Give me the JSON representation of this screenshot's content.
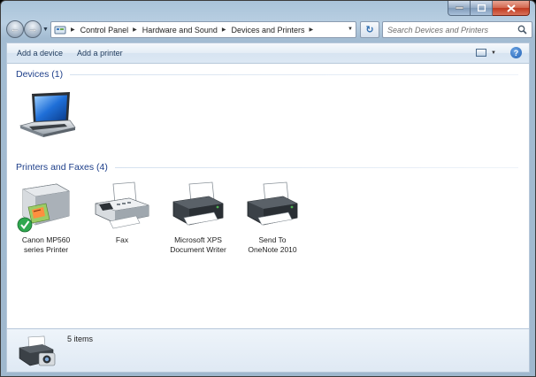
{
  "nav": {
    "breadcrumbs": [
      "Control Panel",
      "Hardware and Sound",
      "Devices and Printers"
    ],
    "search_placeholder": "Search Devices and Printers"
  },
  "commands": {
    "add_device": "Add a device",
    "add_printer": "Add a printer"
  },
  "groups": {
    "devices": {
      "title": "Devices (1)",
      "items": [
        {
          "label": "",
          "icon": "laptop-icon"
        }
      ]
    },
    "printers": {
      "title": "Printers and Faxes (4)",
      "items": [
        {
          "label_line1": "Canon MP560",
          "label_line2": "series Printer",
          "icon": "multifunction-printer-icon",
          "default": true
        },
        {
          "label_line1": "Fax",
          "label_line2": "",
          "icon": "fax-icon"
        },
        {
          "label_line1": "Microsoft XPS",
          "label_line2": "Document Writer",
          "icon": "printer-icon"
        },
        {
          "label_line1": "Send To",
          "label_line2": "OneNote 2010",
          "icon": "printer-icon"
        }
      ]
    }
  },
  "details": {
    "count": "5 items"
  }
}
